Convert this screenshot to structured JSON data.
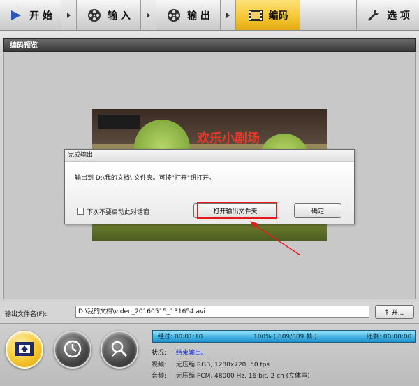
{
  "toolbar": {
    "start_label": "开 始",
    "input_label": "输 入",
    "output_label": "输 出",
    "encode_label": "编码",
    "options_label": "选 项"
  },
  "section": {
    "title": "编码预览"
  },
  "dialog": {
    "title": "完成输出",
    "message": "输出到 D:\\我的文档\\ 文件夹。可按\"打开\"钮打开。",
    "dont_show_label": "下次不要启动此对话窗",
    "open_folder_button": "打开输出文件夹",
    "ok_button": "确定"
  },
  "video_sign": "欢乐小剧场",
  "output": {
    "label": "输出文件名(F):",
    "value": "D:\\我的文档\\video_20160515_131654.avi",
    "open_button": "打开..."
  },
  "progress": {
    "elapsed": "经过: 00:01:10",
    "text": "100% ( 809/809  帧 )",
    "remaining": "还剩: 00:00:00",
    "fraction": 1.0
  },
  "info": {
    "status_label": "状况:",
    "status_value": "结束输出。",
    "video_label": "视频:",
    "video_value": "无压缩 RGB, 1280x720, 50 fps",
    "audio_label": "音频:",
    "audio_value": "无压缩 PCM, 48000 Hz, 16 bit, 2 ch (立体声)"
  },
  "colors": {
    "accent_yellow": "#f4c531",
    "highlight_red": "#e51919",
    "status_blue": "#1a2fd1"
  }
}
